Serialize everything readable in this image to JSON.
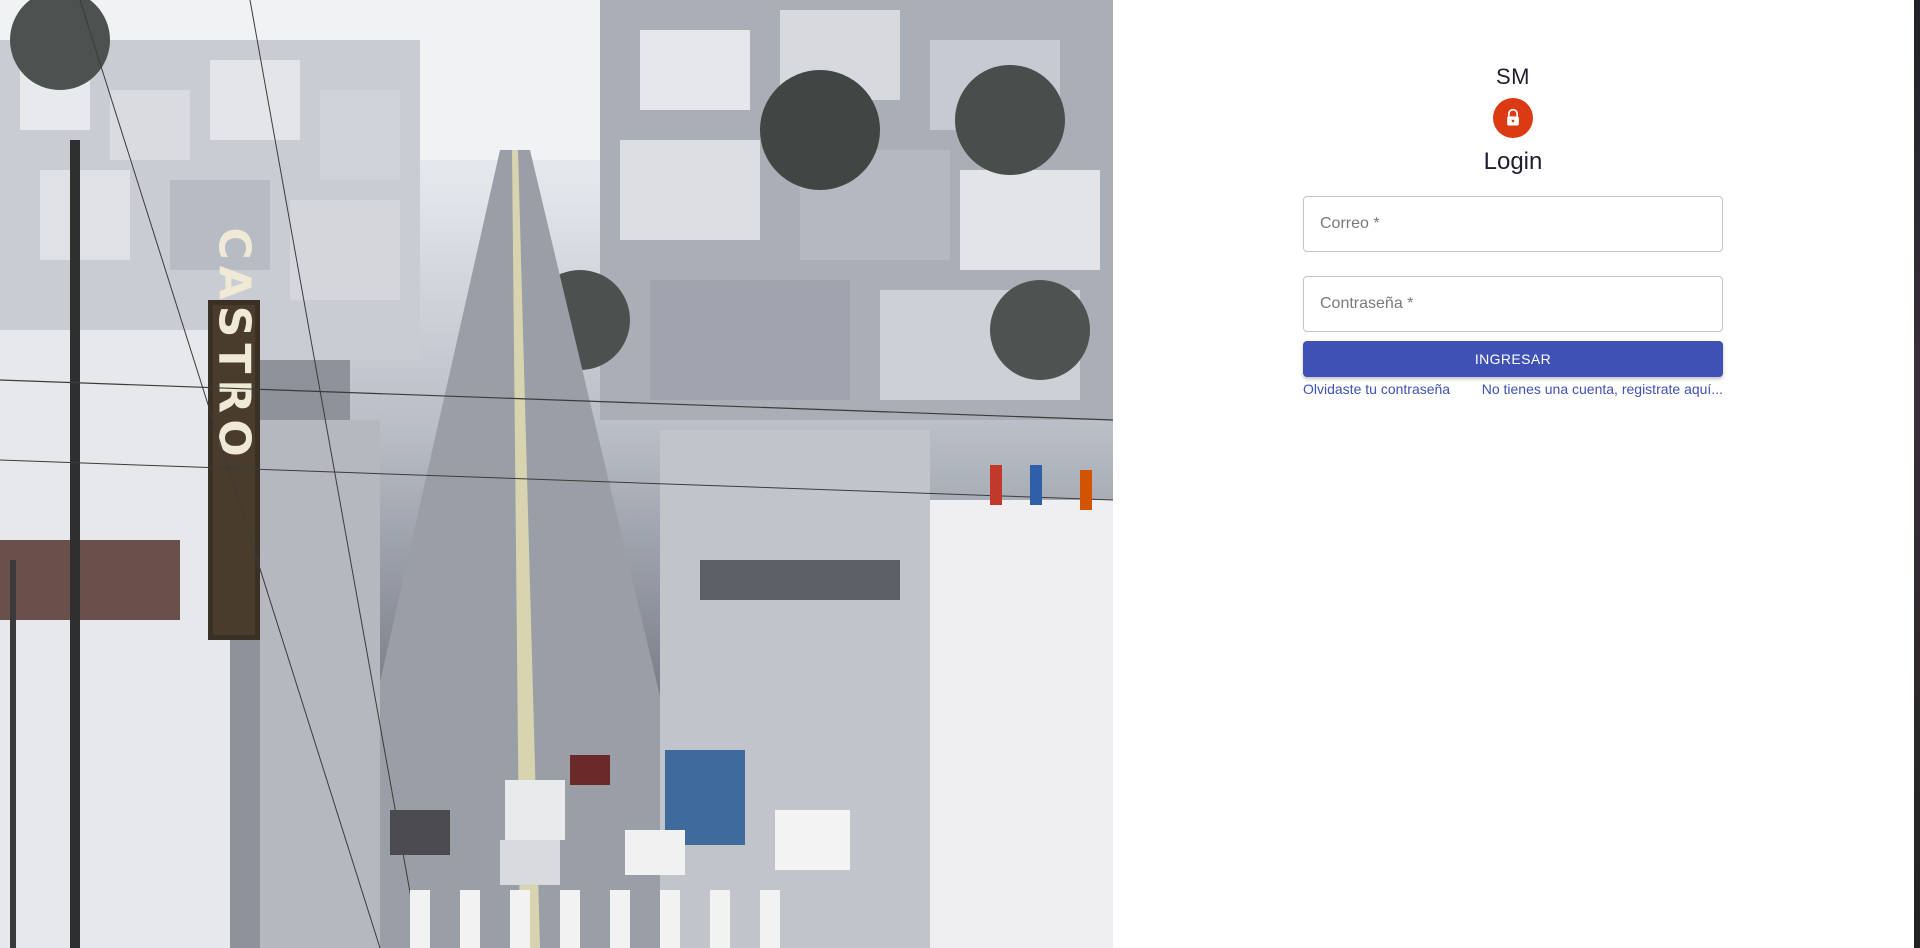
{
  "hero": {
    "sign_text": "CASTRO"
  },
  "login": {
    "brand": "SM",
    "title": "Login",
    "email_placeholder": "Correo *",
    "password_placeholder": "Contraseña *",
    "submit_label": "INGRESAR",
    "forgot_link": "Olvidaste tu contraseña",
    "register_link": "No tienes una cuenta, registrate aquí..."
  },
  "icons": {
    "avatar": "lock-icon"
  },
  "colors": {
    "accent": "#3f51b5",
    "avatar_bg": "#dc3a12"
  }
}
